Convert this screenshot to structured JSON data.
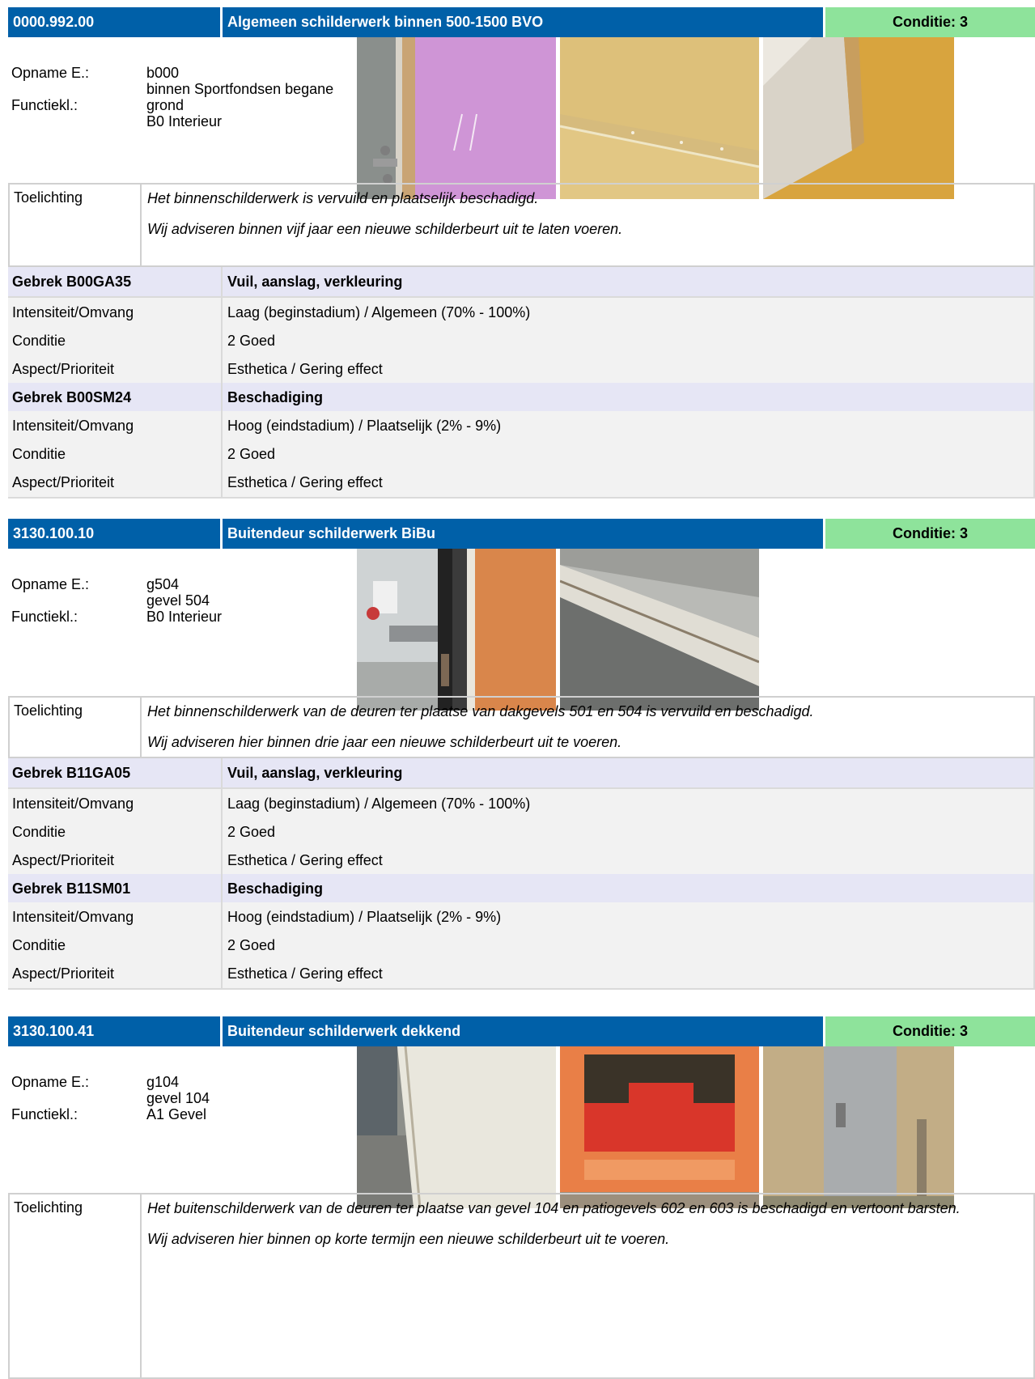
{
  "labels": {
    "opname": "Opname E.:",
    "functie": "Functiekl.:",
    "toelichting": "Toelichting",
    "intensiteit": "Intensiteit/Omvang",
    "conditie": "Conditie",
    "aspect": "Aspect/Prioriteit"
  },
  "sections": [
    {
      "code": "0000.992.00",
      "title": "Algemeen schilderwerk binnen 500-1500 BVO",
      "condition": "Conditie: 3",
      "opname_lines": [
        "b000",
        "binnen Sportfondsen begane",
        "grond",
        "B0 Interieur"
      ],
      "toelichting": [
        "Het binnenschilderwerk is vervuild en plaatselijk beschadigd.",
        "Wij adviseren binnen vijf jaar een nieuwe schilderbeurt uit te laten voeren."
      ],
      "gebreken": [
        {
          "code": "Gebrek B00GA35",
          "name": "Vuil, aanslag, verkleuring",
          "intensiteit": "Laag (beginstadium) / Algemeen (70% - 100%)",
          "conditie": "2 Goed",
          "aspect": "Esthetica / Gering effect"
        },
        {
          "code": "Gebrek B00SM24",
          "name": "Beschadiging",
          "intensiteit": "Hoog (eindstadium) / Plaatselijk (2% - 9%)",
          "conditie": "2 Goed",
          "aspect": "Esthetica / Gering effect"
        }
      ]
    },
    {
      "code": "3130.100.10",
      "title": "Buitendeur schilderwerk BiBu",
      "condition": "Conditie: 3",
      "opname_lines": [
        "g504",
        "gevel 504",
        "B0 Interieur"
      ],
      "toelichting": [
        "Het binnenschilderwerk van de deuren ter plaatse van dakgevels 501 en 504 is vervuild en beschadigd.",
        "Wij adviseren hier binnen drie jaar een nieuwe schilderbeurt uit te voeren."
      ],
      "gebreken": [
        {
          "code": "Gebrek B11GA05",
          "name": "Vuil, aanslag, verkleuring",
          "intensiteit": "Laag (beginstadium) / Algemeen (70% - 100%)",
          "conditie": "2 Goed",
          "aspect": "Esthetica / Gering effect"
        },
        {
          "code": "Gebrek B11SM01",
          "name": "Beschadiging",
          "intensiteit": "Hoog (eindstadium) / Plaatselijk (2% - 9%)",
          "conditie": "2 Goed",
          "aspect": "Esthetica / Gering effect"
        }
      ]
    },
    {
      "code": "3130.100.41",
      "title": "Buitendeur schilderwerk dekkend",
      "condition": "Conditie: 3",
      "opname_lines": [
        "g104",
        "gevel 104",
        "A1 Gevel"
      ],
      "toelichting": [
        "Het buitenschilderwerk van de deuren ter plaatse van gevel 104 en patiogevels 602 en 603 is beschadigd en vertoont barsten.",
        "Wij adviseren hier binnen op korte termijn een nieuwe schilderbeurt uit te voeren."
      ]
    }
  ]
}
